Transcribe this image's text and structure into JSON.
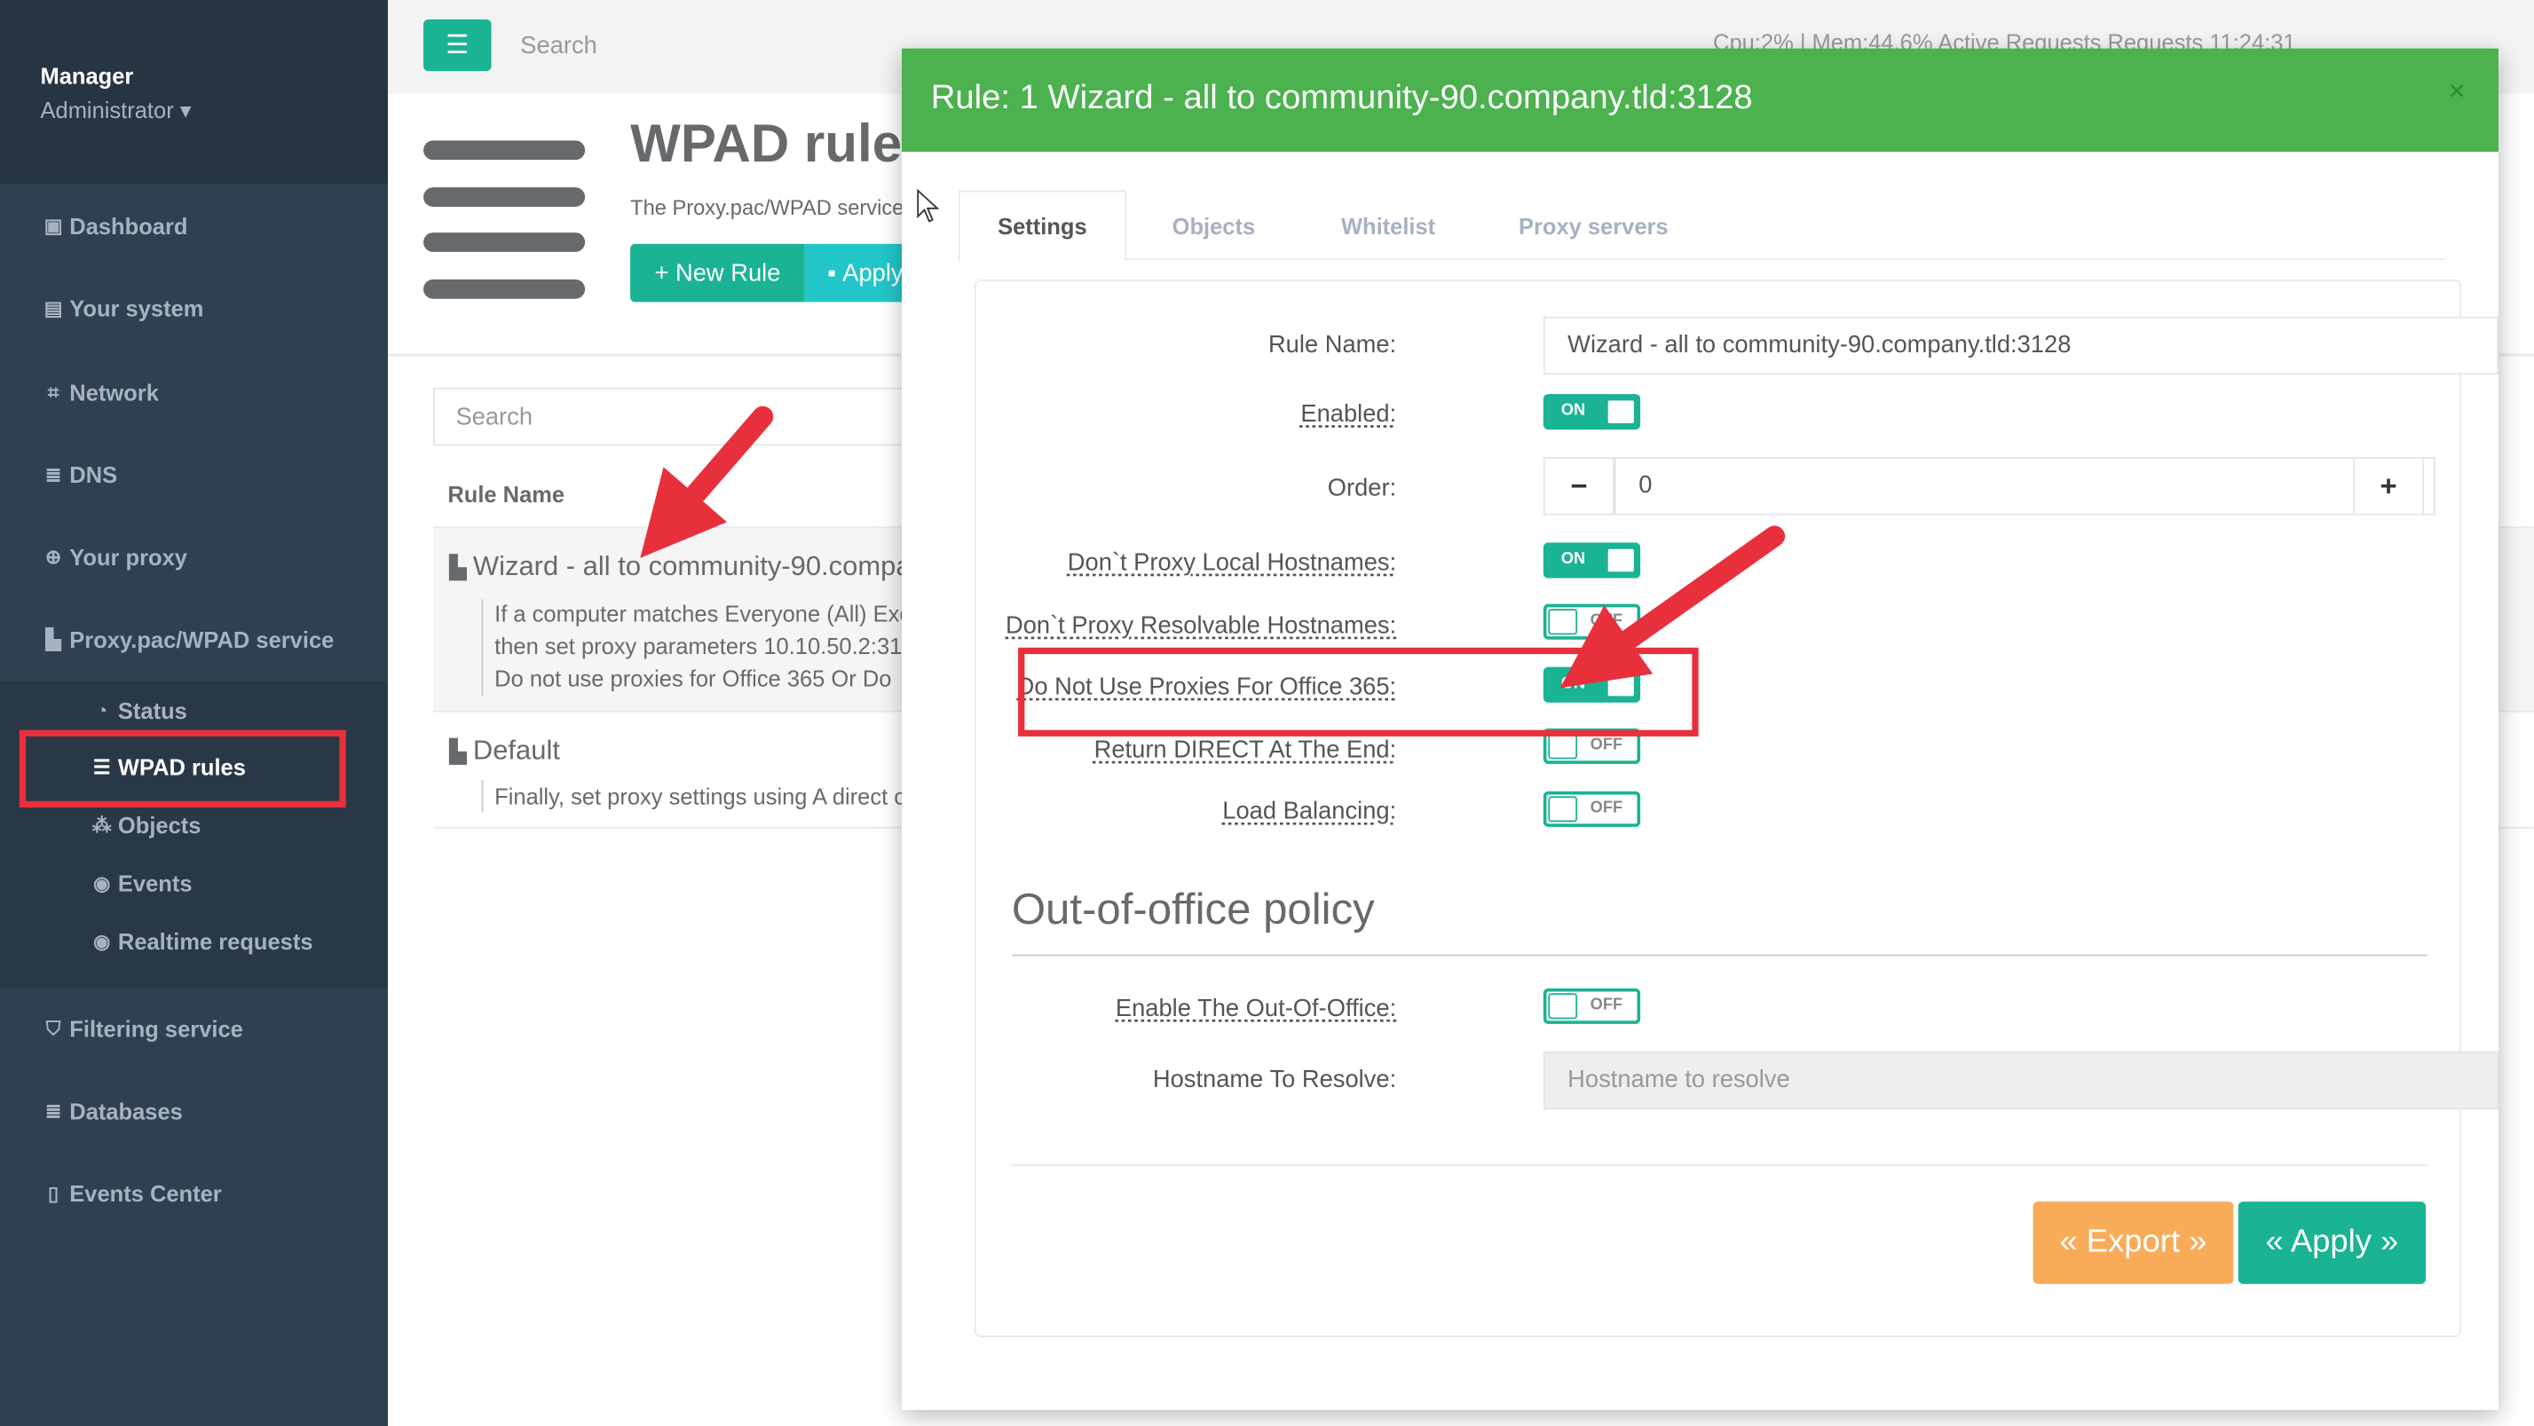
{
  "sidebar": {
    "user_name": "Manager",
    "user_role": "Administrator ▾",
    "items": [
      {
        "label": "Dashboard",
        "icon": "dashboard-icon",
        "glyph": "▣"
      },
      {
        "label": "Your system",
        "icon": "server-icon",
        "glyph": "▤"
      },
      {
        "label": "Network",
        "icon": "sitemap-icon",
        "glyph": "⌗"
      },
      {
        "label": "DNS",
        "icon": "database-icon",
        "glyph": "≣"
      },
      {
        "label": "Your proxy",
        "icon": "globe-icon",
        "glyph": "⊕"
      },
      {
        "label": "Proxy.pac/WPAD service",
        "icon": "scroll-icon",
        "glyph": "▙"
      }
    ],
    "sub_items": [
      {
        "label": "Status",
        "icon": "dashboard-gauge-icon",
        "glyph": "◔"
      },
      {
        "label": "WPAD rules",
        "icon": "list-icon",
        "glyph": "☰"
      },
      {
        "label": "Objects",
        "icon": "cubes-icon",
        "glyph": "⁂"
      },
      {
        "label": "Events",
        "icon": "eye-icon",
        "glyph": "◉"
      },
      {
        "label": "Realtime requests",
        "icon": "eye-icon",
        "glyph": "◉"
      }
    ],
    "items_bottom": [
      {
        "label": "Filtering service",
        "icon": "shield-icon",
        "glyph": "⛉"
      },
      {
        "label": "Databases",
        "icon": "database-icon",
        "glyph": "≣"
      },
      {
        "label": "Events Center",
        "icon": "file-icon",
        "glyph": "▯"
      }
    ]
  },
  "topbar": {
    "menu_icon": "☰",
    "search_placeholder": "Search",
    "stats": "Cpu:2% | Mem:44.6%   Active Requests   Requests   11:24:31"
  },
  "page": {
    "title": "WPAD rules",
    "description": "The Proxy.pac/WPAD service",
    "new_rule_label": "+ New Rule",
    "apply_label": "Apply"
  },
  "list": {
    "search_placeholder": "Search",
    "column_header": "Rule Name",
    "rows": [
      {
        "title": "Wizard - all to community-90.company.tld:3128",
        "lines": [
          "If a computer matches Everyone (All) Exc",
          "then set proxy parameters 10.10.50.2:31",
          "Do not use proxies for Office 365 Or  Do"
        ]
      },
      {
        "title": "Default",
        "lines": [
          "Finally, set proxy settings using A direct c"
        ]
      }
    ]
  },
  "modal": {
    "title": "Rule: 1 Wizard - all to community-90.company.tld:3128",
    "close": "×",
    "tabs": [
      "Settings",
      "Objects",
      "Whitelist",
      "Proxy servers"
    ],
    "fields": {
      "rule_name_label": "Rule Name:",
      "rule_name_value": "Wizard - all to community-90.company.tld:3128",
      "enabled_label": "Enabled:",
      "order_label": "Order:",
      "order_value": "0",
      "dont_proxy_local_label": "Don`t Proxy Local Hostnames:",
      "dont_proxy_resolvable_label": "Don`t Proxy Resolvable Hostnames:",
      "office365_label": "Do Not Use Proxies For Office 365:",
      "return_direct_label": "Return DIRECT At The End:",
      "load_balancing_label": "Load Balancing:"
    },
    "toggles": {
      "enabled": "ON",
      "dont_proxy_local": "ON",
      "dont_proxy_resolvable": "OFF",
      "office365": "ON",
      "return_direct": "OFF",
      "load_balancing": "OFF",
      "out_of_office": "OFF"
    },
    "section": {
      "title": "Out-of-office policy",
      "enable_label": "Enable The Out-Of-Office:",
      "hostname_label": "Hostname To Resolve:",
      "hostname_placeholder": "Hostname to resolve"
    },
    "buttons": {
      "export": "« Export »",
      "apply": "« Apply »"
    }
  },
  "colors": {
    "sidebar": "#2f4050",
    "primary": "#1ab394",
    "header_green": "#4cb14f",
    "annotation_red": "#e8303c",
    "warning": "#f8ac59"
  }
}
